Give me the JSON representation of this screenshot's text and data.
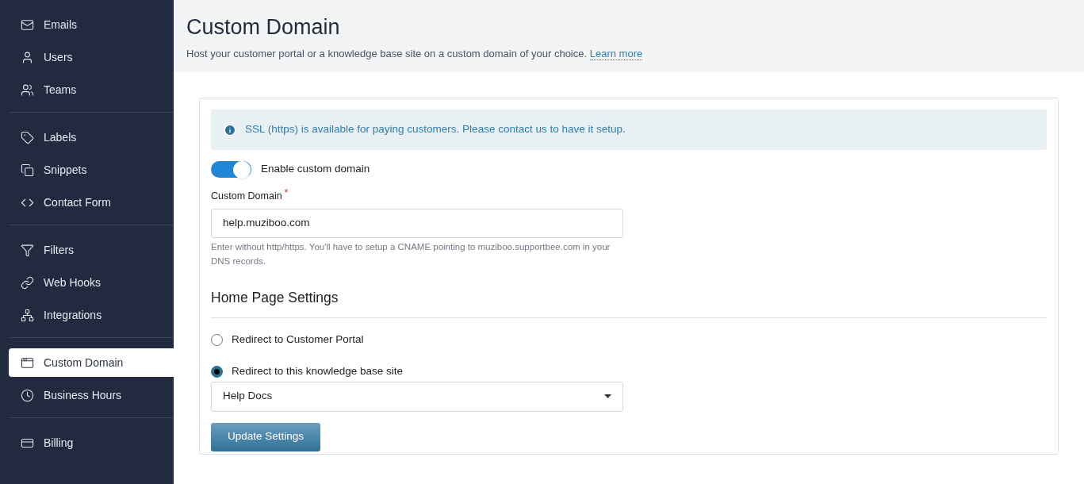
{
  "sidebar": {
    "groups": [
      {
        "items": [
          {
            "label": "Emails",
            "selected": false
          },
          {
            "label": "Users",
            "selected": false
          },
          {
            "label": "Teams",
            "selected": false
          }
        ]
      },
      {
        "items": [
          {
            "label": "Labels",
            "selected": false
          },
          {
            "label": "Snippets",
            "selected": false
          },
          {
            "label": "Contact Form",
            "selected": false
          }
        ]
      },
      {
        "items": [
          {
            "label": "Filters",
            "selected": false
          },
          {
            "label": "Web Hooks",
            "selected": false
          },
          {
            "label": "Integrations",
            "selected": false
          }
        ]
      },
      {
        "items": [
          {
            "label": "Custom Domain",
            "selected": true
          },
          {
            "label": "Business Hours",
            "selected": false
          }
        ]
      },
      {
        "items": [
          {
            "label": "Billing",
            "selected": false
          }
        ]
      }
    ]
  },
  "header": {
    "title": "Custom Domain",
    "description": "Host your customer portal or a knowledge base site on a custom domain of your choice.",
    "link": "Learn more"
  },
  "notice": "SSL (https) is available for paying customers. Please contact us to have it setup.",
  "toggle": {
    "label": "Enable custom domain",
    "on": true
  },
  "domain_field": {
    "label": "Custom Domain",
    "required": "*",
    "value": "help.muziboo.com",
    "help": "Enter without http/https. You'll have to setup a CNAME pointing to muziboo.supportbee.com in your DNS records."
  },
  "home_page": {
    "title": "Home Page Settings",
    "options": [
      {
        "label": "Redirect to Customer Portal",
        "selected": false
      },
      {
        "label": "Redirect to this knowledge base site",
        "selected": true
      }
    ],
    "select": {
      "value": "Help Docs"
    }
  },
  "submit": "Update Settings"
}
